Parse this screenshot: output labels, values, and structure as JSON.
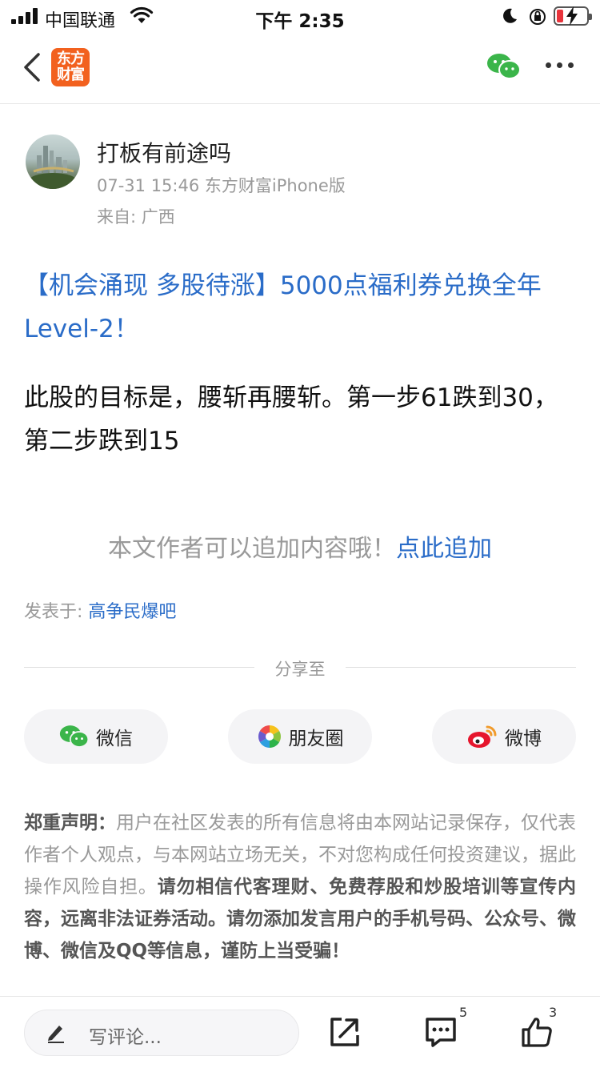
{
  "status_bar": {
    "carrier": "中国联通",
    "time": "下午 2:35"
  },
  "nav": {
    "logo_line1": "东方",
    "logo_line2": "财富"
  },
  "post": {
    "author": "打板有前途吗",
    "meta": "07-31 15:46  东方财富iPhone版",
    "location": "来自: 广西",
    "promo_link": "【机会涌现 多股待涨】5000点福利券兑换全年Level-2！",
    "content": "此股的目标是，腰斩再腰斩。第一步61跌到30，第二步跌到15",
    "append_prompt": "本文作者可以追加内容哦！",
    "append_link": "点此追加",
    "posted_in_label": "发表于: ",
    "posted_in_bar": "高争民爆吧"
  },
  "share": {
    "label": "分享至",
    "wechat": "微信",
    "moments": "朋友圈",
    "weibo": "微博"
  },
  "disclaimer": {
    "title": "郑重声明：",
    "body": "用户在社区发表的所有信息将由本网站记录保存，仅代表作者个人观点，与本网站立场无关，不对您构成任何投资建议，据此操作风险自担。",
    "warning": "请勿相信代客理财、免费荐股和炒股培训等宣传内容，远离非法证券活动。请勿添加发言用户的手机号码、公众号、微博、微信及QQ等信息，谨防上当受骗！"
  },
  "bottom_bar": {
    "comment_placeholder": "写评论...",
    "comment_count": "5",
    "like_count": "3"
  }
}
